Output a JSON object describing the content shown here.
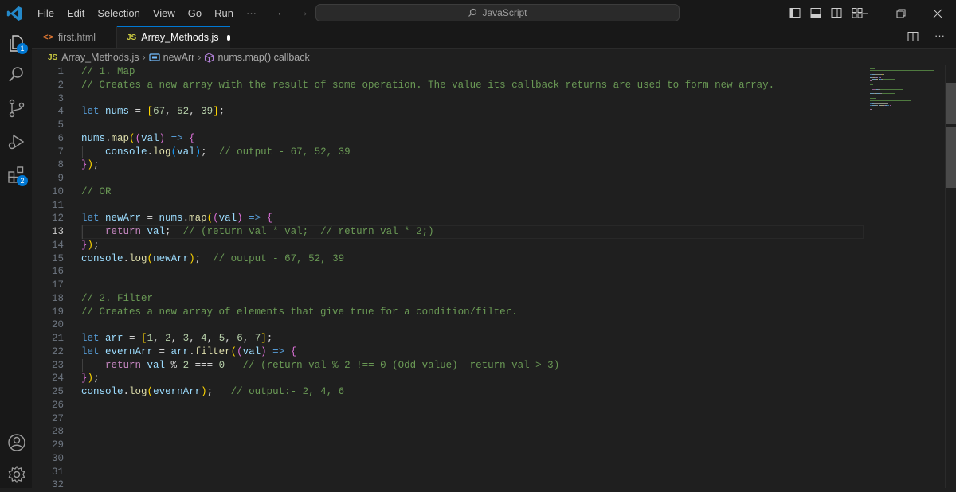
{
  "menu": [
    "File",
    "Edit",
    "Selection",
    "View",
    "Go",
    "Run",
    "···"
  ],
  "command_center": {
    "label": "JavaScript"
  },
  "activity_badges": {
    "explorer": "1",
    "extensions": "2"
  },
  "tabs": [
    {
      "label": "first.html",
      "icon": "html-file-icon"
    },
    {
      "label": "Array_Methods.js",
      "icon": "js-file-icon",
      "active": true,
      "dirty": true
    }
  ],
  "breadcrumb": {
    "file": "Array_Methods.js",
    "symbol1": "newArr",
    "symbol2": "nums.map() callback"
  },
  "editor": {
    "active_line": 13,
    "lines": [
      {
        "n": "1",
        "code": [
          [
            "c",
            "// 1. Map"
          ]
        ]
      },
      {
        "n": "2",
        "code": [
          [
            "c",
            "// Creates a new array with the result of some operation. The value its callback returns are used to form new array."
          ]
        ]
      },
      {
        "n": "3",
        "code": []
      },
      {
        "n": "4",
        "code": [
          [
            "k",
            "let "
          ],
          [
            "v",
            "nums"
          ],
          [
            "p",
            " = "
          ],
          [
            "b1",
            "["
          ],
          [
            "n",
            "67"
          ],
          [
            "p",
            ", "
          ],
          [
            "n",
            "52"
          ],
          [
            "p",
            ", "
          ],
          [
            "n",
            "39"
          ],
          [
            "b1",
            "]"
          ],
          [
            "p",
            ";"
          ]
        ]
      },
      {
        "n": "5",
        "code": []
      },
      {
        "n": "6",
        "code": [
          [
            "v",
            "nums"
          ],
          [
            "p",
            "."
          ],
          [
            "f",
            "map"
          ],
          [
            "b1",
            "("
          ],
          [
            "b2",
            "("
          ],
          [
            "v",
            "val"
          ],
          [
            "b2",
            ")"
          ],
          [
            "p",
            " "
          ],
          [
            "k",
            "=>"
          ],
          [
            "p",
            " "
          ],
          [
            "b2",
            "{"
          ]
        ]
      },
      {
        "n": "7",
        "code": [
          [
            "p",
            "    "
          ],
          [
            "v",
            "console"
          ],
          [
            "p",
            "."
          ],
          [
            "f",
            "log"
          ],
          [
            "b3",
            "("
          ],
          [
            "v",
            "val"
          ],
          [
            "b3",
            ")"
          ],
          [
            "p",
            ";  "
          ],
          [
            "c",
            "// output - 67, 52, 39"
          ]
        ]
      },
      {
        "n": "8",
        "code": [
          [
            "b2",
            "}"
          ],
          [
            "b1",
            ")"
          ],
          [
            "p",
            ";"
          ]
        ]
      },
      {
        "n": "9",
        "code": []
      },
      {
        "n": "10",
        "code": [
          [
            "c",
            "// OR"
          ]
        ]
      },
      {
        "n": "11",
        "code": []
      },
      {
        "n": "12",
        "code": [
          [
            "k",
            "let "
          ],
          [
            "v",
            "newArr"
          ],
          [
            "p",
            " = "
          ],
          [
            "v",
            "nums"
          ],
          [
            "p",
            "."
          ],
          [
            "f",
            "map"
          ],
          [
            "b1",
            "("
          ],
          [
            "b2",
            "("
          ],
          [
            "v",
            "val"
          ],
          [
            "b2",
            ")"
          ],
          [
            "p",
            " "
          ],
          [
            "k",
            "=>"
          ],
          [
            "p",
            " "
          ],
          [
            "b2",
            "{"
          ]
        ]
      },
      {
        "n": "13",
        "code": [
          [
            "p",
            "    "
          ],
          [
            "kr",
            "return "
          ],
          [
            "v",
            "val"
          ],
          [
            "p",
            ";  "
          ],
          [
            "c",
            "// (return val * val;  // return val * 2;)"
          ]
        ]
      },
      {
        "n": "14",
        "code": [
          [
            "b2",
            "}"
          ],
          [
            "b1",
            ")"
          ],
          [
            "p",
            ";"
          ]
        ]
      },
      {
        "n": "15",
        "code": [
          [
            "v",
            "console"
          ],
          [
            "p",
            "."
          ],
          [
            "f",
            "log"
          ],
          [
            "b1",
            "("
          ],
          [
            "v",
            "newArr"
          ],
          [
            "b1",
            ")"
          ],
          [
            "p",
            ";  "
          ],
          [
            "c",
            "// output - 67, 52, 39"
          ]
        ]
      },
      {
        "n": "16",
        "code": []
      },
      {
        "n": "17",
        "code": []
      },
      {
        "n": "18",
        "code": [
          [
            "c",
            "// 2. Filter"
          ]
        ]
      },
      {
        "n": "19",
        "code": [
          [
            "c",
            "// Creates a new array of elements that give true for a condition/filter."
          ]
        ]
      },
      {
        "n": "20",
        "code": []
      },
      {
        "n": "21",
        "code": [
          [
            "k",
            "let "
          ],
          [
            "v",
            "arr"
          ],
          [
            "p",
            " = "
          ],
          [
            "b1",
            "["
          ],
          [
            "n",
            "1"
          ],
          [
            "p",
            ", "
          ],
          [
            "n",
            "2"
          ],
          [
            "p",
            ", "
          ],
          [
            "n",
            "3"
          ],
          [
            "p",
            ", "
          ],
          [
            "n",
            "4"
          ],
          [
            "p",
            ", "
          ],
          [
            "n",
            "5"
          ],
          [
            "p",
            ", "
          ],
          [
            "n",
            "6"
          ],
          [
            "p",
            ", "
          ],
          [
            "n",
            "7"
          ],
          [
            "b1",
            "]"
          ],
          [
            "p",
            ";"
          ]
        ]
      },
      {
        "n": "22",
        "code": [
          [
            "k",
            "let "
          ],
          [
            "v",
            "evernArr"
          ],
          [
            "p",
            " = "
          ],
          [
            "v",
            "arr"
          ],
          [
            "p",
            "."
          ],
          [
            "f",
            "filter"
          ],
          [
            "b1",
            "("
          ],
          [
            "b2",
            "("
          ],
          [
            "v",
            "val"
          ],
          [
            "b2",
            ")"
          ],
          [
            "p",
            " "
          ],
          [
            "k",
            "=>"
          ],
          [
            "p",
            " "
          ],
          [
            "b2",
            "{"
          ]
        ]
      },
      {
        "n": "23",
        "code": [
          [
            "p",
            "    "
          ],
          [
            "kr",
            "return "
          ],
          [
            "v",
            "val"
          ],
          [
            "p",
            " % "
          ],
          [
            "n",
            "2"
          ],
          [
            "p",
            " === "
          ],
          [
            "n",
            "0"
          ],
          [
            "p",
            "   "
          ],
          [
            "c",
            "// (return val % 2 !== 0 (Odd value)  return val > 3)"
          ]
        ]
      },
      {
        "n": "24",
        "code": [
          [
            "b2",
            "}"
          ],
          [
            "b1",
            ")"
          ],
          [
            "p",
            ";"
          ]
        ]
      },
      {
        "n": "25",
        "code": [
          [
            "v",
            "console"
          ],
          [
            "p",
            "."
          ],
          [
            "f",
            "log"
          ],
          [
            "b1",
            "("
          ],
          [
            "v",
            "evernArr"
          ],
          [
            "b1",
            ")"
          ],
          [
            "p",
            ";   "
          ],
          [
            "c",
            "// output:- 2, 4, 6"
          ]
        ]
      },
      {
        "n": "26",
        "code": []
      },
      {
        "n": "27",
        "code": []
      },
      {
        "n": "28",
        "code": []
      },
      {
        "n": "29",
        "code": []
      },
      {
        "n": "30",
        "code": []
      },
      {
        "n": "31",
        "code": []
      },
      {
        "n": "32",
        "code": []
      }
    ]
  },
  "colors": {
    "accent": "#0078d4",
    "comment": "#6a9955",
    "keyword": "#569cd6",
    "variable": "#9cdcfe",
    "function": "#dcdcaa",
    "number": "#b5cea8",
    "control": "#c586c0"
  }
}
